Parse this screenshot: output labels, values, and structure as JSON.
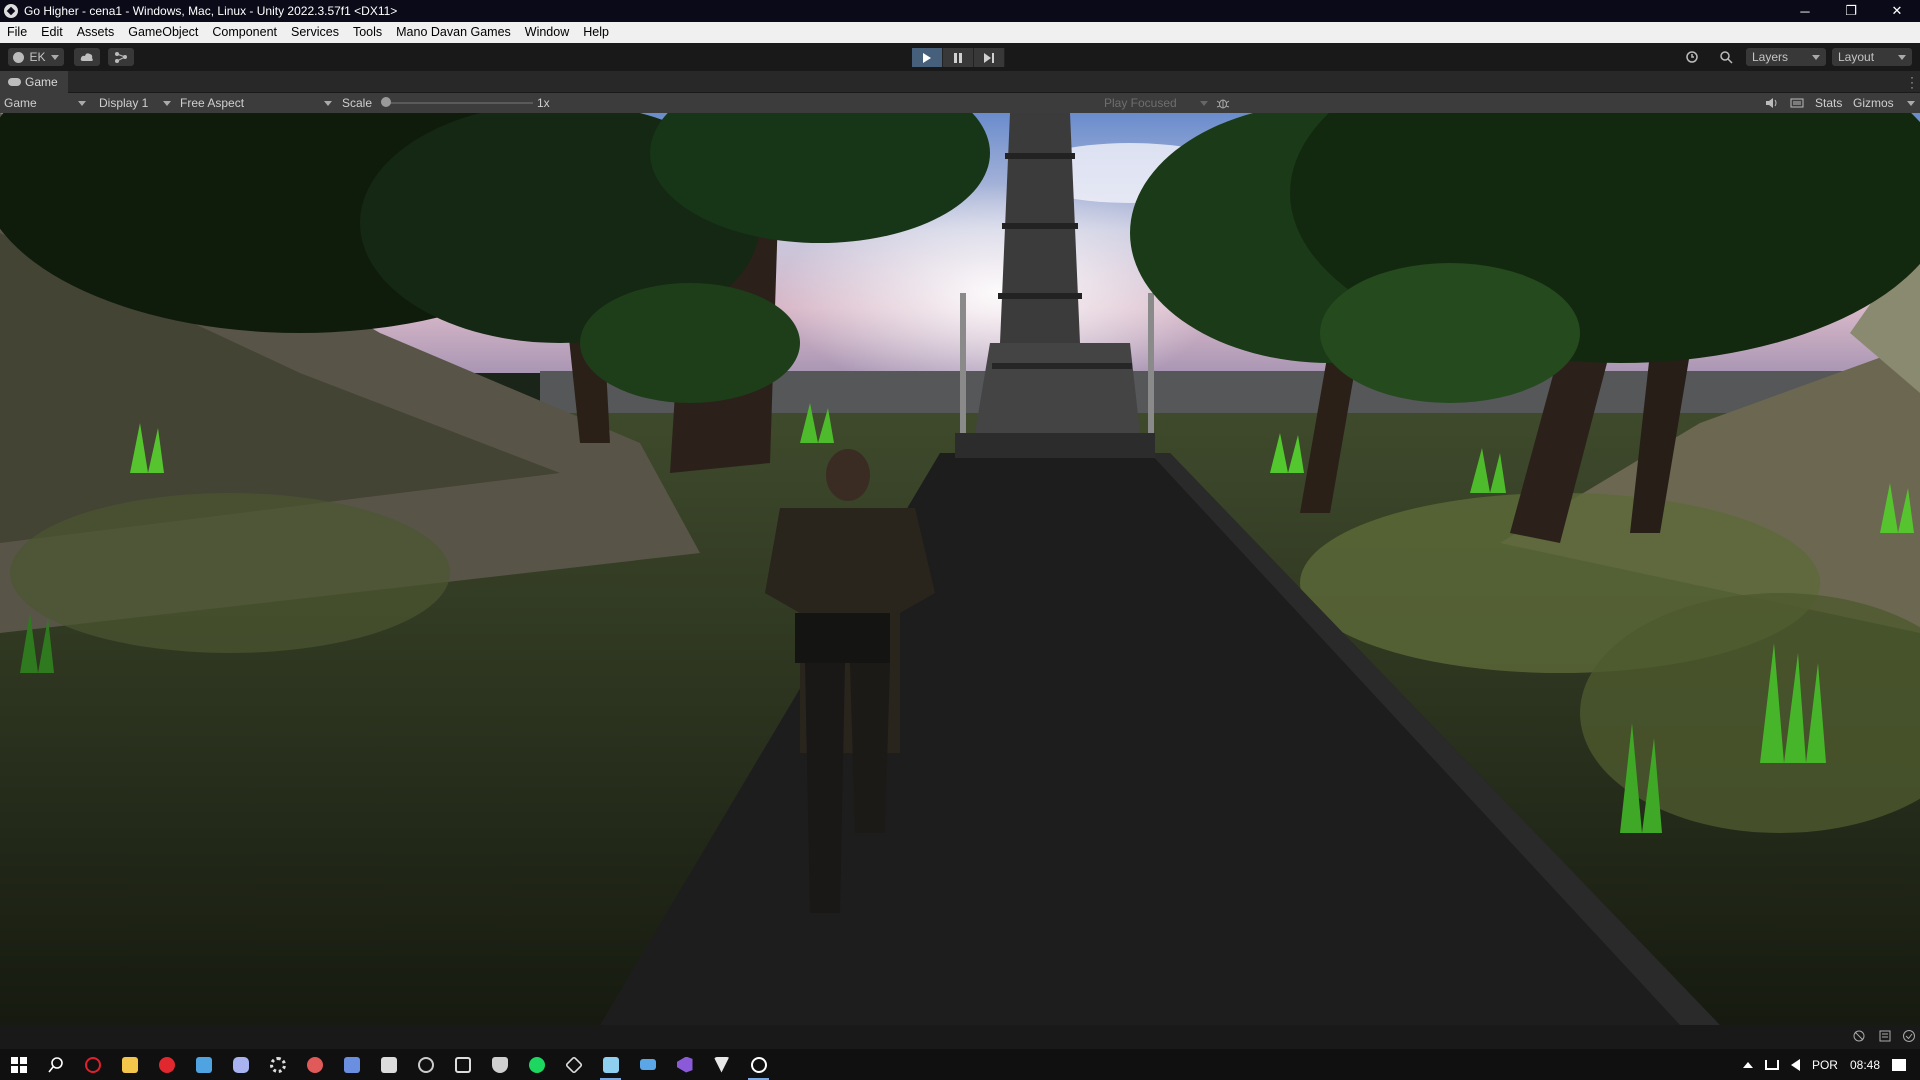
{
  "titlebar": {
    "title": "Go Higher - cena1 - Windows, Mac, Linux - Unity 2022.3.57f1 <DX11>",
    "minimize": "─",
    "restore": "❐",
    "close": "✕"
  },
  "menu": [
    "File",
    "Edit",
    "Assets",
    "GameObject",
    "Component",
    "Services",
    "Tools",
    "Mano Davan Games",
    "Window",
    "Help"
  ],
  "toolbar": {
    "account": "EK",
    "layers": "Layers",
    "layout": "Layout"
  },
  "tab": {
    "label": "Game"
  },
  "gamebar": {
    "mode": "Game",
    "display": "Display 1",
    "aspect": "Free Aspect",
    "scale_label": "Scale",
    "scale_value": "1x",
    "play_focused": "Play Focused",
    "stats": "Stats",
    "gizmos": "Gizmos"
  },
  "tray": {
    "language": "POR",
    "time": "08:48"
  },
  "colors": {
    "accent": "#46607c",
    "sky_top": "#6a8ccc",
    "grass": "#4dbb2c"
  }
}
